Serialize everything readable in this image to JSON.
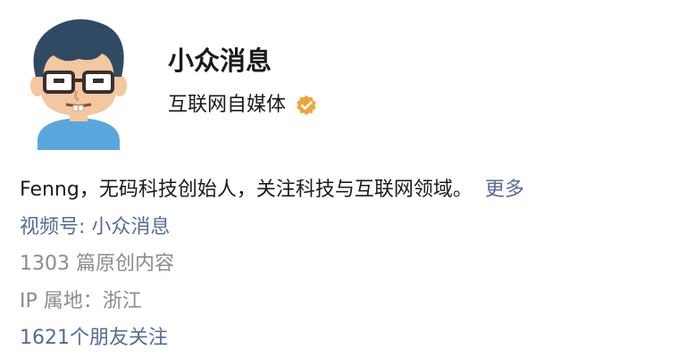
{
  "profile": {
    "name": "小众消息",
    "type": "互联网自媒体",
    "verified_icon": "verified-badge-icon",
    "avatar_icon": "cartoon-avatar-icon",
    "bio": "Fenng，无码科技创始人，关注科技与互联网领域。",
    "more_label": "更多",
    "channel_label": "视频号: 小众消息",
    "articles": "1303 篇原创内容",
    "ip_location": "IP 属地：浙江",
    "friends_following": "1621个朋友关注"
  },
  "colors": {
    "link": "#576b95",
    "muted": "#8c8c8c",
    "badge": "#f2a33a"
  }
}
